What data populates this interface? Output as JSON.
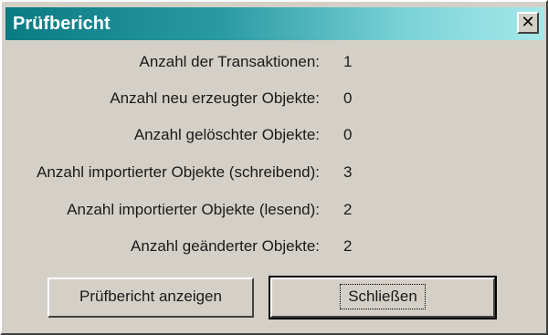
{
  "dialog": {
    "title": "Prüfbericht",
    "close_glyph": "✕"
  },
  "stats": [
    {
      "label": "Anzahl der Transaktionen:",
      "value": "1"
    },
    {
      "label": "Anzahl neu erzeugter Objekte:",
      "value": "0"
    },
    {
      "label": "Anzahl gelöschter Objekte:",
      "value": "0"
    },
    {
      "label": "Anzahl importierter Objekte (schreibend):",
      "value": "3"
    },
    {
      "label": "Anzahl importierter Objekte (lesend):",
      "value": "2"
    },
    {
      "label": "Anzahl geänderter Objekte:",
      "value": "2"
    }
  ],
  "buttons": {
    "show_report": "Prüfbericht anzeigen",
    "close": "Schließen"
  },
  "colors": {
    "title_gradient_start": "#0a7b83",
    "title_gradient_end": "#a6e8ea",
    "face": "#d4d0c8"
  }
}
